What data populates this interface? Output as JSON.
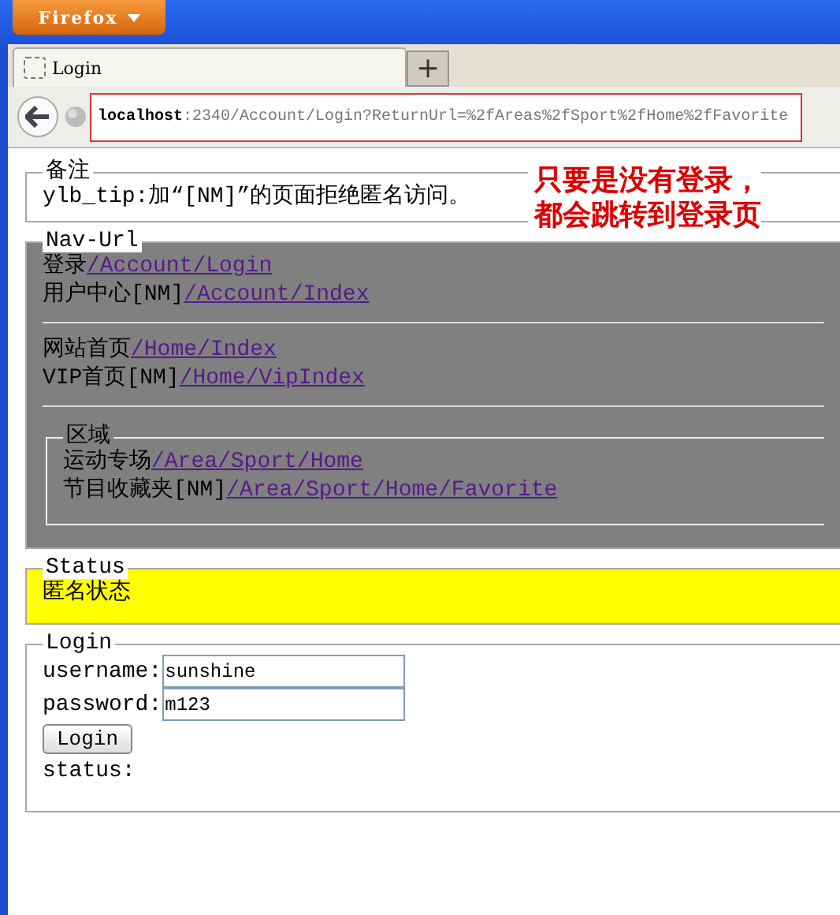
{
  "browser": {
    "menu_button": "Firefox",
    "tabs": [
      {
        "title": "Login",
        "selected": true
      }
    ],
    "new_tab": "+",
    "url": {
      "host": "localhost",
      "rest": ":2340/Account/Login?ReturnUrl=%2fAreas%2fSport%2fHome%2fFavorite"
    }
  },
  "annotation": [
    "只要是没有登录，",
    "都会跳转到登录页"
  ],
  "remark": {
    "legend": "备注",
    "text": "ylb_tip:加“[NM]”的页面拒绝匿名访问。"
  },
  "nav": {
    "legend": "Nav-Url",
    "groups": [
      [
        {
          "label": "登录",
          "href": "/Account/Login"
        },
        {
          "label": "用户中心[NM]",
          "href": "/Account/Index"
        }
      ],
      [
        {
          "label": "网站首页",
          "href": "/Home/Index"
        },
        {
          "label": "VIP首页[NM]",
          "href": "/Home/VipIndex"
        }
      ]
    ],
    "area": {
      "legend": "区域",
      "links": [
        {
          "label": "运动专场",
          "href": "/Area/Sport/Home"
        },
        {
          "label": "节目收藏夹[NM]",
          "href": "/Area/Sport/Home/Favorite"
        }
      ]
    }
  },
  "status": {
    "legend": "Status",
    "text": "匿名状态"
  },
  "login": {
    "legend": "Login",
    "fields": [
      {
        "label": "username:",
        "value": "sunshine"
      },
      {
        "label": "password:",
        "value": "m123"
      }
    ],
    "button": "Login",
    "status_label": "status:"
  }
}
